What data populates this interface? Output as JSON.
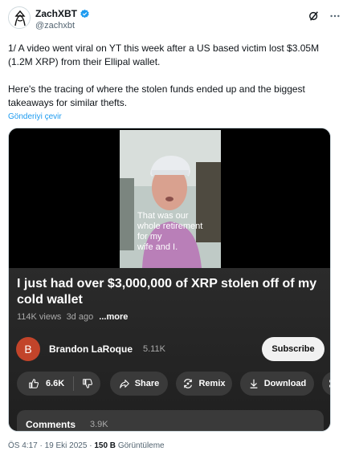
{
  "author": {
    "display_name": "ZachXBT",
    "handle": "@zachxbt"
  },
  "tweet": {
    "paragraph_1": "1/ A video went viral on YT this week after a US based victim lost $3.05M (1.2M XRP) from their Ellipal wallet.",
    "paragraph_2": "Here's the tracing of where the stolen funds ended up and the biggest takeaways for similar thefts.",
    "translate_label": "Gönderiyi çevir"
  },
  "video": {
    "caption_lines": [
      "That was our",
      "whole retirement",
      "for my",
      "wife and I."
    ],
    "title": "I just had over $3,000,000 of XRP stolen off of my cold wallet",
    "views": "114K views",
    "age": "3d ago",
    "more_label": "...more",
    "channel": {
      "avatar_letter": "B",
      "name": "Brandon LaRoque",
      "subscribers": "5.11K"
    },
    "subscribe_label": "Subscribe",
    "actions": {
      "like_count": "6.6K",
      "share": "Share",
      "remix": "Remix",
      "download": "Download"
    },
    "comments": {
      "label": "Comments",
      "count": "3.9K"
    }
  },
  "footer": {
    "time": "ÖS 4:17",
    "date": "19 Eki 2025",
    "views_count": "150 B",
    "views_label": "Görüntüleme"
  },
  "icons": {
    "verified": "verified-badge-icon",
    "grok": "grok-icon",
    "more": "more-icon",
    "like": "thumbs-up-icon",
    "dislike": "thumbs-down-icon",
    "share": "share-arrow-icon",
    "remix": "remix-icon",
    "download": "download-icon",
    "clip": "scissors-icon"
  },
  "colors": {
    "link": "#1d9bf0",
    "verified": "#1d9bf0",
    "channel_avatar": "#c2442a"
  }
}
